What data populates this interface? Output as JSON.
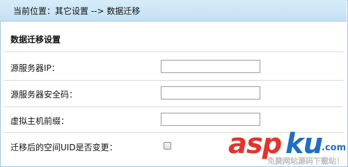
{
  "breadcrumb": {
    "text": "当前位置：其它设置 --> 数据迁移"
  },
  "section": {
    "title": "数据迁移设置"
  },
  "form": {
    "source_ip": {
      "label": "源服务器IP：",
      "value": ""
    },
    "source_code": {
      "label": "源服务器安全码：",
      "value": ""
    },
    "host_prefix": {
      "label": "虚拟主机前缀：",
      "value": ""
    },
    "uid_change": {
      "label": "迁移后的空间UID是否变更：",
      "checked": false
    }
  },
  "watermark": {
    "brand": "aspku",
    "brand_suffix": ".com",
    "subtitle": "免费网站源码下载站！"
  }
}
